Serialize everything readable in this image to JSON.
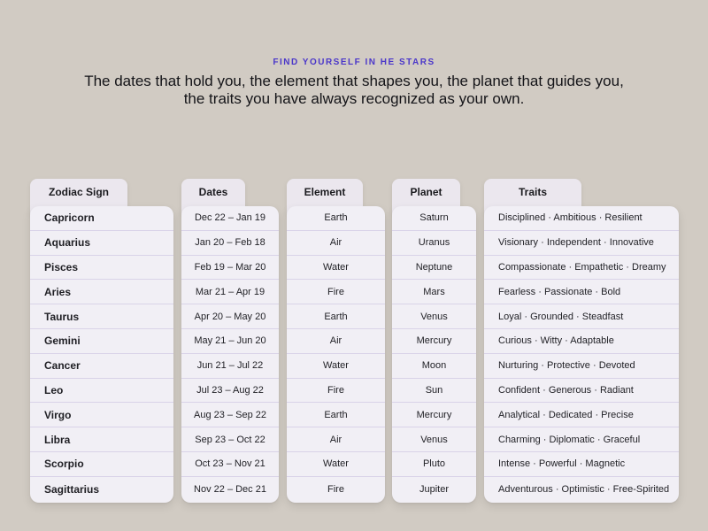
{
  "header": {
    "eyebrow": "FIND YOURSELF IN HE STARS",
    "headline_line1": "The dates that hold you, the element that shapes you, the planet that guides you,",
    "headline_line2": "the traits you have always recognized as your own."
  },
  "columns": {
    "sign": "Zodiac Sign",
    "dates": "Dates",
    "element": "Element",
    "planet": "Planet",
    "traits": "Traits"
  },
  "rows": [
    {
      "sign": "Capricorn",
      "dates": "Dec 22 – Jan 19",
      "element": "Earth",
      "planet": "Saturn",
      "traits": "Disciplined · Ambitious · Resilient"
    },
    {
      "sign": "Aquarius",
      "dates": "Jan 20 – Feb 18",
      "element": "Air",
      "planet": "Uranus",
      "traits": "Visionary · Independent · Innovative"
    },
    {
      "sign": "Pisces",
      "dates": "Feb 19 – Mar 20",
      "element": "Water",
      "planet": "Neptune",
      "traits": "Compassionate · Empathetic · Dreamy"
    },
    {
      "sign": "Aries",
      "dates": "Mar 21 – Apr 19",
      "element": "Fire",
      "planet": "Mars",
      "traits": "Fearless · Passionate · Bold"
    },
    {
      "sign": "Taurus",
      "dates": "Apr 20 – May 20",
      "element": "Earth",
      "planet": "Venus",
      "traits": "Loyal · Grounded · Steadfast"
    },
    {
      "sign": "Gemini",
      "dates": "May 21 – Jun 20",
      "element": "Air",
      "planet": "Mercury",
      "traits": "Curious · Witty · Adaptable"
    },
    {
      "sign": "Cancer",
      "dates": "Jun 21 – Jul 22",
      "element": "Water",
      "planet": "Moon",
      "traits": "Nurturing · Protective · Devoted"
    },
    {
      "sign": "Leo",
      "dates": "Jul 23 – Aug 22",
      "element": "Fire",
      "planet": "Sun",
      "traits": "Confident · Generous · Radiant"
    },
    {
      "sign": "Virgo",
      "dates": "Aug 23 – Sep 22",
      "element": "Earth",
      "planet": "Mercury",
      "traits": "Analytical · Dedicated · Precise"
    },
    {
      "sign": "Libra",
      "dates": "Sep 23 – Oct 22",
      "element": "Air",
      "planet": "Venus",
      "traits": "Charming · Diplomatic · Graceful"
    },
    {
      "sign": "Scorpio",
      "dates": "Oct 23 – Nov 21",
      "element": "Water",
      "planet": "Pluto",
      "traits": "Intense · Powerful · Magnetic"
    },
    {
      "sign": "Sagittarius",
      "dates": "Nov 22 – Dec 21",
      "element": "Fire",
      "planet": "Jupiter",
      "traits": "Adventurous · Optimistic · Free-Spirited"
    }
  ],
  "colors": {
    "background": "#d1cbc3",
    "accent": "#4b37c9",
    "card": "#f1eff5",
    "tab": "#ebe7ee"
  }
}
